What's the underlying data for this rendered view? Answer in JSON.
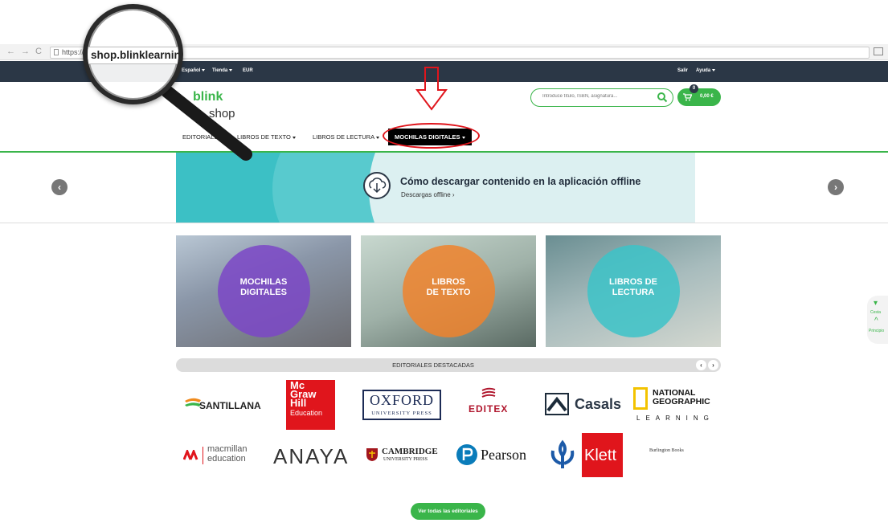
{
  "browser": {
    "url_prefix": "https://",
    "url_main": "shop.blinklearning.com/es"
  },
  "topbar": {
    "language": "Español",
    "store": "Tienda",
    "currency": "EUR",
    "logout": "Salir",
    "help": "Ayuda"
  },
  "header": {
    "logo_blink": "blink",
    "logo_shop": "shop",
    "search_placeholder": "Introduce título, ISBN, asignatura...",
    "cart_count": "0",
    "cart_amount": "0,00 €"
  },
  "nav": {
    "items": [
      "EDITORIALES",
      "LIBROS DE TEXTO",
      "LIBROS DE LECTURA",
      "MOCHILAS DIGITALES"
    ]
  },
  "banner": {
    "title": "Cómo descargar contenido en la aplicación offline",
    "subtitle": "Descargas offline ›"
  },
  "tiles": [
    {
      "label_line1": "MOCHILAS",
      "label_line2": "DIGITALES",
      "color": "#7b46c7"
    },
    {
      "label_line1": "LIBROS",
      "label_line2": "DE TEXTO",
      "color": "#f0832c"
    },
    {
      "label_line1": "LIBROS DE",
      "label_line2": "LECTURA",
      "color": "#3cc3c8"
    }
  ],
  "editoriales": {
    "heading": "EDITORIALES DESTACADAS",
    "brands_row1": [
      "SANTILLANA",
      "Mc Graw Hill Education",
      "OXFORD",
      "UNIVERSITY PRESS",
      "EDITEX",
      "Casals",
      "NATIONAL GEOGRAPHIC",
      "LEARNING"
    ],
    "brands_row2": [
      "macmillan",
      "education",
      "ANAYA",
      "CAMBRIDGE",
      "UNIVERSITY PRESS",
      "Pearson",
      "Klett",
      "Burlington Books"
    ],
    "mgh_lines": [
      "Mc",
      "Graw",
      "Hill",
      "Education"
    ],
    "button": "Ver todas las editoriales"
  },
  "widget": {
    "cart_label": "Cesta",
    "top_label": "Principio"
  },
  "colors": {
    "brand_green": "#3ab54a",
    "dark_bar": "#2b3746",
    "highlight_red": "#e0151c"
  }
}
